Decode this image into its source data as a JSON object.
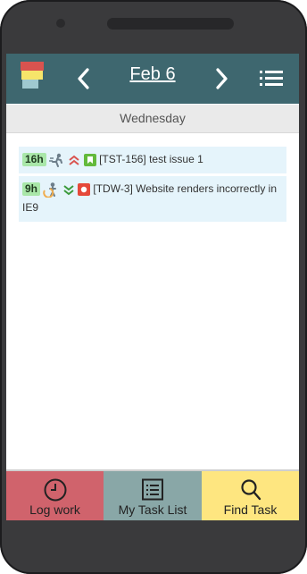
{
  "header": {
    "date": "Feb 6"
  },
  "day_label": "Wednesday",
  "tasks": [
    {
      "hours": "16h",
      "text": "[TST-156] test issue 1",
      "priority_icon": "chevrons-up-icon",
      "type_icon": "bookmark-icon",
      "status_icon": "running-person-icon"
    },
    {
      "hours": "9h",
      "text": "[TDW-3] Website renders incorrectly in IE9",
      "priority_icon": "chevrons-down-icon",
      "type_icon": "bug-icon",
      "status_icon": "person-in-progress-icon"
    }
  ],
  "bottom_nav": {
    "log_work": "Log work",
    "task_list": "My Task List",
    "find_task": "Find Task"
  },
  "colors": {
    "header": "#3e676f",
    "log_work": "#d0636c",
    "task_list": "#89a7a7",
    "find_task": "#fee680",
    "task_bg": "#e5f4fb",
    "hours_badge": "#a9e7a9"
  }
}
